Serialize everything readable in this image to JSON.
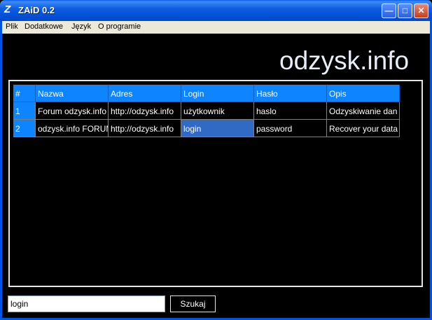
{
  "window": {
    "title": "ZAiD 0.2",
    "app_icon": "Z"
  },
  "menu": [
    "Plik",
    "Dodatkowe",
    "Język",
    "O programie"
  ],
  "brand": "odzysk.info",
  "table": {
    "columns": [
      "#",
      "Nazwa",
      "Adres",
      "Login",
      "Hasło",
      "Opis"
    ],
    "rows": [
      [
        "1",
        "Forum odzysk.info",
        "http://odzysk.info",
        "użytkownik",
        "haslo",
        "Odzyskiwanie dan"
      ],
      [
        "2",
        "odzysk.info FORUM",
        "http://odzysk.info",
        "login",
        "password",
        "Recover your data"
      ]
    ]
  },
  "search": {
    "value": "login",
    "button_label": "Szukaj"
  },
  "colors": {
    "header": "#0f84ff",
    "selection": "#316ac5"
  }
}
